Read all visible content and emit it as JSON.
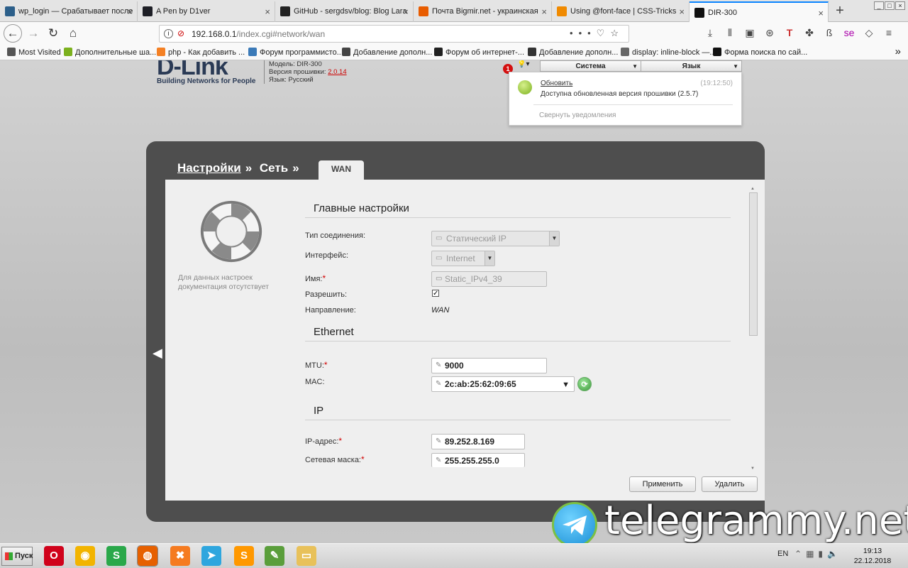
{
  "browser": {
    "tabs": [
      {
        "title": "wp_login — Срабатывает после",
        "icon": "wordpress-icon",
        "color": "#2c5f8a"
      },
      {
        "title": "A Pen by D1ver",
        "icon": "codepen-icon",
        "color": "#1e1f26"
      },
      {
        "title": "GitHub - sergdsv/blog: Blog Lara",
        "icon": "github-icon",
        "color": "#222"
      },
      {
        "title": "Почта Bigmir.net - украинская",
        "icon": "bigmir-icon",
        "color": "#e85c00"
      },
      {
        "title": "Using @font-face | CSS-Tricks",
        "icon": "css-tricks-icon",
        "color": "#f08a00"
      },
      {
        "title": "DIR-300",
        "icon": "dlink-icon",
        "color": "#111"
      }
    ],
    "url_host": "192.168.0.1",
    "url_path": "/index.cgi#network/wan",
    "bookmarks": [
      {
        "label": "Most Visited",
        "color": "#555"
      },
      {
        "label": "Дополнительные ша...",
        "color": "#7cb11e"
      },
      {
        "label": "php - Как добавить ...",
        "color": "#f48024"
      },
      {
        "label": "Форум программисто...",
        "color": "#3b7ab8"
      },
      {
        "label": "Добавление дополн...",
        "color": "#444"
      },
      {
        "label": "Форум об интернет-...",
        "color": "#222"
      },
      {
        "label": "Добавление дополн...",
        "color": "#333"
      },
      {
        "label": "display: inline-block —...",
        "color": "#666"
      },
      {
        "label": "Форма поиска по сай...",
        "color": "#111"
      }
    ]
  },
  "router": {
    "brand": "D-Link",
    "tagline": "Building Networks for People",
    "model_line": "Модель: DIR-300",
    "fw_label": "Версия прошивки:",
    "fw_version": "2.0.14",
    "lang_line": "Язык: Русский",
    "menu": {
      "system": "Система",
      "language": "Язык"
    },
    "notif_count": "1",
    "notification": {
      "title": "Обновить",
      "time": "(19:12:50)",
      "text": "Доступна обновленная версия прошивки (2.5.7)",
      "collapse": "Свернуть уведомления"
    },
    "breadcrumb": {
      "c1": "Настройки",
      "c2": "Сеть",
      "sep": "»"
    },
    "active_tab": "WAN",
    "help_text": "Для данных настроек документация отсутствует",
    "sections": {
      "main": "Главные настройки",
      "ethernet": "Ethernet",
      "ip": "IP"
    },
    "fields": {
      "conn_type_label": "Тип соединения:",
      "conn_type_value": "Статический IP",
      "interface_label": "Интерфейс:",
      "interface_value": "Internet",
      "name_label": "Имя:",
      "name_value": "Static_IPv4_39",
      "enable_label": "Разрешить:",
      "enable_checked": true,
      "direction_label": "Направление:",
      "direction_value": "WAN",
      "mtu_label": "MTU:",
      "mtu_value": "9000",
      "mac_label": "MAC:",
      "mac_value": "2c:ab:25:62:09:65",
      "ip_label": "IP-адрес:",
      "ip_value": "89.252.8.169",
      "mask_label": "Сетевая маска:",
      "mask_value": "255.255.255.0"
    },
    "buttons": {
      "apply": "Применить",
      "delete": "Удалить"
    }
  },
  "watermark": "telegrammy.net",
  "taskbar": {
    "start": "Пуск",
    "apps": [
      {
        "name": "opera-icon",
        "color": "#d0021b",
        "glyph": "O"
      },
      {
        "name": "chrome-icon",
        "color": "#f2b400",
        "glyph": "◉"
      },
      {
        "name": "skype-icon",
        "color": "#2aa84a",
        "glyph": "S"
      },
      {
        "name": "firefox-icon",
        "color": "#e66000",
        "glyph": "◍"
      },
      {
        "name": "xampp-icon",
        "color": "#f57b20",
        "glyph": "✖"
      },
      {
        "name": "telegram-icon",
        "color": "#2ea6de",
        "glyph": "➤"
      },
      {
        "name": "sublime-icon",
        "color": "#ff9800",
        "glyph": "S"
      },
      {
        "name": "notepad-icon",
        "color": "#5a9e3b",
        "glyph": "✎"
      },
      {
        "name": "folder-icon",
        "color": "#e8c15a",
        "glyph": "▭"
      }
    ],
    "lang": "EN",
    "time": "19:13",
    "date": "22.12.2018"
  }
}
